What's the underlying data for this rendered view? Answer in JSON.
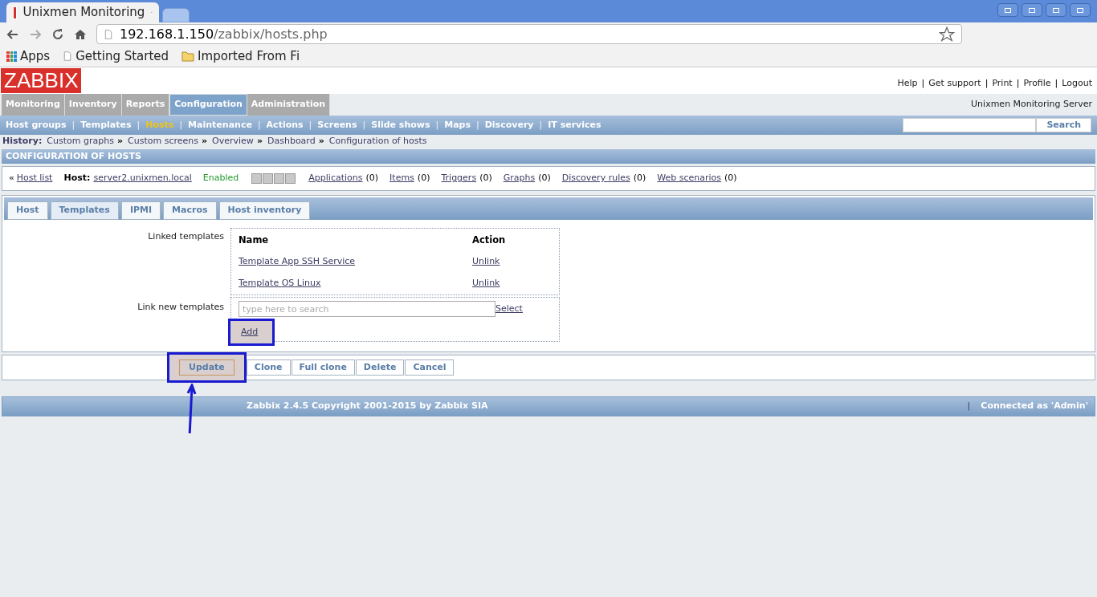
{
  "browser": {
    "tabs": [
      {
        "title": "Unixmen Monitoring",
        "selected": true
      },
      {
        "selected": false
      }
    ],
    "url_host": "192.168.1.150",
    "url_path": "/zabbix/hosts.php",
    "bookmarks": [
      {
        "label": "Apps",
        "kind": "apps"
      },
      {
        "label": "Getting Started",
        "kind": "page"
      },
      {
        "label": "Imported From Fi",
        "kind": "folder"
      }
    ]
  },
  "header": {
    "logo": "ZABBIX",
    "links": [
      "Help",
      "Get support",
      "Print",
      "Profile",
      "Logout"
    ],
    "separator": "|"
  },
  "main_menu": [
    {
      "label": "Monitoring",
      "selected": false
    },
    {
      "label": "Inventory",
      "selected": false
    },
    {
      "label": "Reports",
      "selected": false
    },
    {
      "label": "Configuration",
      "selected": true
    },
    {
      "label": "Administration",
      "selected": false
    }
  ],
  "server_name": "Unixmen Monitoring Server",
  "sub_menu": [
    {
      "label": "Host groups",
      "selected": false
    },
    {
      "label": "Templates",
      "selected": false
    },
    {
      "label": "Hosts",
      "selected": true
    },
    {
      "label": "Maintenance",
      "selected": false
    },
    {
      "label": "Actions",
      "selected": false
    },
    {
      "label": "Screens",
      "selected": false
    },
    {
      "label": "Slide shows",
      "selected": false
    },
    {
      "label": "Maps",
      "selected": false
    },
    {
      "label": "Discovery",
      "selected": false
    },
    {
      "label": "IT services",
      "selected": false
    }
  ],
  "sub_menu_separator": "|",
  "search_button": "Search",
  "history": {
    "label": "History:",
    "items": [
      "Custom graphs",
      "Custom screens",
      "Overview",
      "Dashboard",
      "Configuration of hosts"
    ],
    "separator": "»"
  },
  "section_title": "CONFIGURATION OF HOSTS",
  "host_bar": {
    "back": "«",
    "host_list": "Host list",
    "host_label": "Host:",
    "host_name": "server2.unixmen.local",
    "status": "Enabled",
    "links": [
      {
        "label": "Applications",
        "count": "(0)"
      },
      {
        "label": "Items",
        "count": "(0)"
      },
      {
        "label": "Triggers",
        "count": "(0)"
      },
      {
        "label": "Graphs",
        "count": "(0)"
      },
      {
        "label": "Discovery rules",
        "count": "(0)"
      },
      {
        "label": "Web scenarios",
        "count": "(0)"
      }
    ]
  },
  "form_tabs": [
    {
      "label": "Host",
      "selected": false
    },
    {
      "label": "Templates",
      "selected": true
    },
    {
      "label": "IPMI",
      "selected": false
    },
    {
      "label": "Macros",
      "selected": false
    },
    {
      "label": "Host inventory",
      "selected": false
    }
  ],
  "linked_templates": {
    "label": "Linked templates",
    "columns": [
      "Name",
      "Action"
    ],
    "rows": [
      {
        "name": "Template App SSH Service",
        "action": "Unlink"
      },
      {
        "name": "Template OS Linux",
        "action": "Unlink"
      }
    ]
  },
  "link_new": {
    "label": "Link new templates",
    "placeholder": "type here to search",
    "select": "Select",
    "add": {
      "label": "Add",
      "highlighted": true
    }
  },
  "buttons": [
    {
      "label": "Update",
      "kind": "primary",
      "highlighted": true
    },
    {
      "label": "Clone",
      "kind": "secondary",
      "highlighted": false
    },
    {
      "label": "Full clone",
      "kind": "secondary",
      "highlighted": false
    },
    {
      "label": "Delete",
      "kind": "secondary",
      "highlighted": false
    },
    {
      "label": "Cancel",
      "kind": "secondary",
      "highlighted": false
    }
  ],
  "footer": {
    "copyright": "Zabbix 2.4.5 Copyright 2001-2015 by Zabbix SIA",
    "separator": "|",
    "connected": "Connected as 'Admin'"
  }
}
